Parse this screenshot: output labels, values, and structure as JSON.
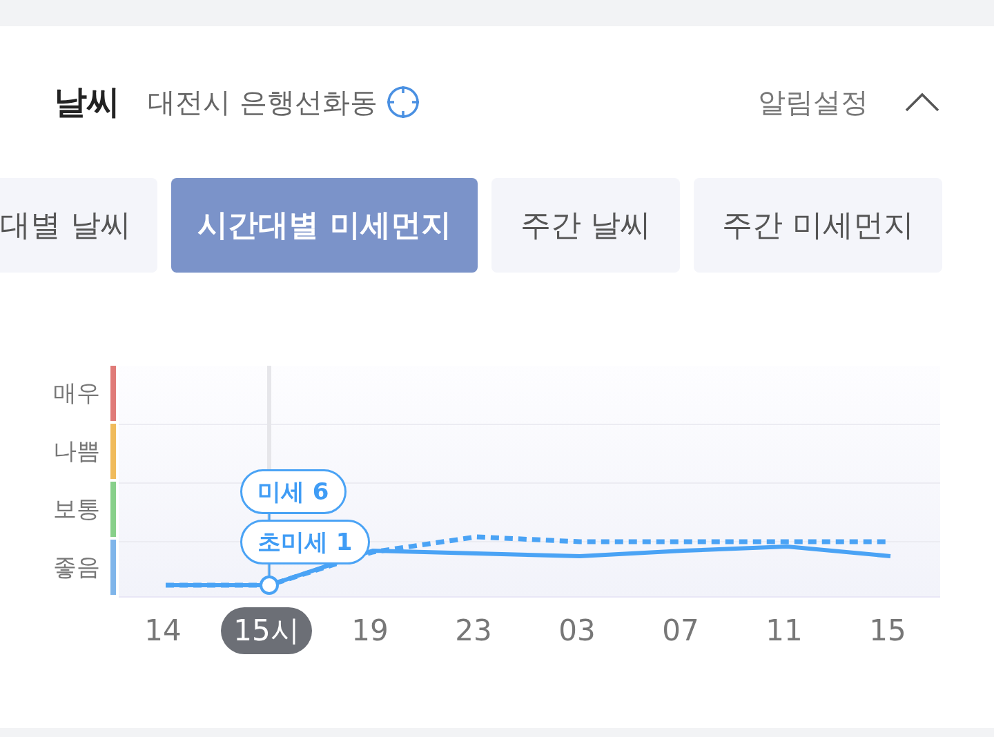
{
  "header": {
    "title": "날씨",
    "location": "대전시 은행선화동",
    "alert_settings": "알림설정",
    "expanded": true
  },
  "tabs": [
    {
      "label": "대별 날씨",
      "selected": false
    },
    {
      "label": "시간대별 미세먼지",
      "selected": true
    },
    {
      "label": "주간 날씨",
      "selected": false
    },
    {
      "label": "주간 미세먼지",
      "selected": false
    }
  ],
  "chart": {
    "levels": [
      {
        "label": "매우",
        "color": "#e07b78"
      },
      {
        "label": "나쁨",
        "color": "#f0bb5c"
      },
      {
        "label": "보통",
        "color": "#88d08a"
      },
      {
        "label": "좋음",
        "color": "#7fb5ea"
      }
    ],
    "x_labels": [
      {
        "label": "14",
        "selected": false
      },
      {
        "label": "15시",
        "selected": true
      },
      {
        "label": "19",
        "selected": false
      },
      {
        "label": "23",
        "selected": false
      },
      {
        "label": "03",
        "selected": false
      },
      {
        "label": "07",
        "selected": false
      },
      {
        "label": "11",
        "selected": false
      },
      {
        "label": "15",
        "selected": false
      }
    ],
    "tooltips": [
      {
        "text": "미세 6"
      },
      {
        "text": "초미세 1"
      }
    ]
  }
}
